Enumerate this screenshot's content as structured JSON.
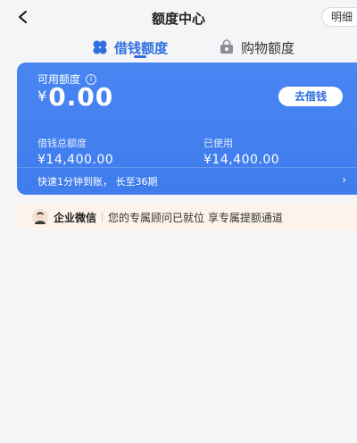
{
  "header": {
    "title": "额度中心",
    "back_icon": "chevron-left-icon",
    "detail_link": "明细"
  },
  "tabs": [
    {
      "label": "借钱额度",
      "icon": "clover-icon",
      "active": true,
      "color": "#2f6fe0"
    },
    {
      "label": "购物额度",
      "icon": "shopping-bag-icon",
      "active": false,
      "color": "#333333"
    }
  ],
  "card": {
    "available_label": "可用额度",
    "info_icon": "info-icon",
    "currency": "¥",
    "available_amount": "0.00",
    "borrow_button": "去借钱",
    "total_label": "借钱总额度",
    "total_value": "¥14,400.00",
    "used_label": "已使用",
    "used_value": "¥14,400.00",
    "footer_text": "快速1分钟到账， 长至36期",
    "footer_arrow": "›",
    "color": "#4a86f2"
  },
  "banner": {
    "avatar_icon": "advisor-avatar-icon",
    "title": "企业微信",
    "message": "您的专属顾问已就位 享专属提额通道",
    "color": "#fdf3ea"
  }
}
